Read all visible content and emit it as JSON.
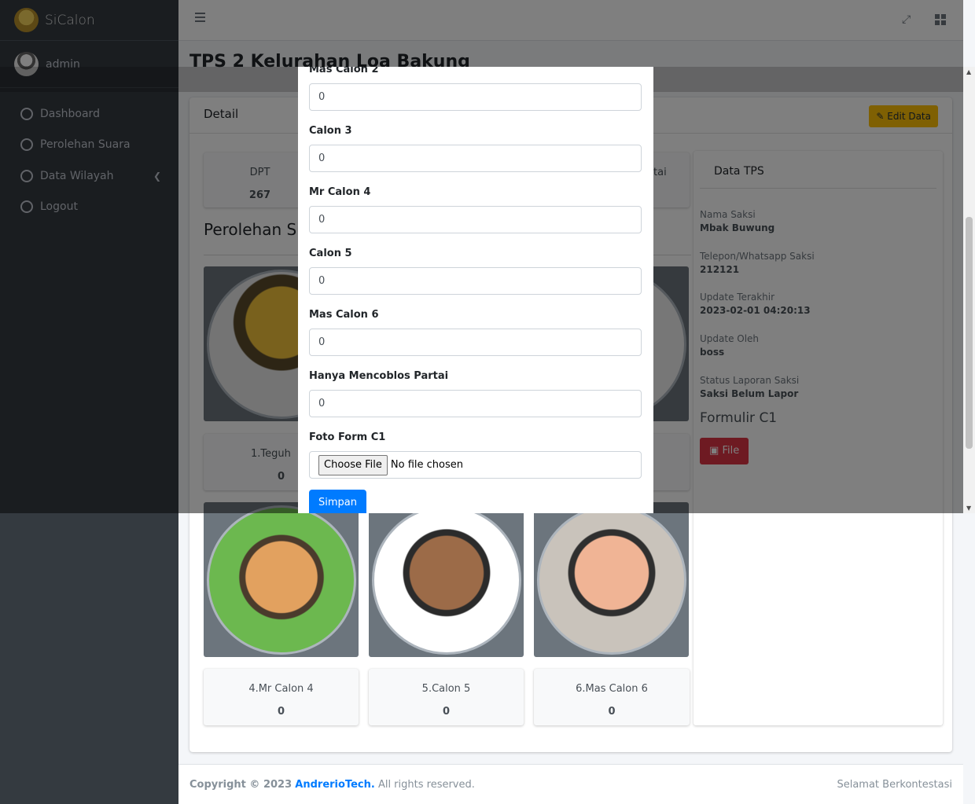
{
  "brand": {
    "name": "SiCalon"
  },
  "user": {
    "name": "admin"
  },
  "nav": {
    "items": [
      {
        "label": "Dashboard"
      },
      {
        "label": "Perolehan Suara"
      },
      {
        "label": "Data Wilayah"
      },
      {
        "label": "Logout"
      }
    ]
  },
  "page": {
    "title": "TPS 2 Kelurahan Loa Bakung"
  },
  "card": {
    "title": "Detail",
    "edit_label": "Edit Data"
  },
  "stats": [
    {
      "label": "DPT",
      "value": "267"
    }
  ],
  "stats_partial_label": "tai",
  "section": {
    "title": "Perolehan Suara",
    "partial": "Perolehan Su"
  },
  "candidates_top": [
    {
      "name_partial": "1.Teguh",
      "votes": "0"
    }
  ],
  "candidates_bottom": [
    {
      "name": "4.Mr Calon 4",
      "votes": "0"
    },
    {
      "name": "5.Calon 5",
      "votes": "0"
    },
    {
      "name": "6.Mas Calon 6",
      "votes": "0"
    }
  ],
  "tps": {
    "title": "Data TPS",
    "fields": [
      {
        "label": "Nama Saksi",
        "value": "Mbak Buwung"
      },
      {
        "label": "Telepon/Whatsapp Saksi",
        "value": "212121"
      },
      {
        "label": "Update Terakhir",
        "value": "2023-02-01 04:20:13"
      },
      {
        "label": "Update Oleh",
        "value": "boss"
      },
      {
        "label": "Status Laporan Saksi",
        "value": "Saksi Belum Lapor"
      }
    ],
    "form_title": "Formulir C1",
    "file_label": "File"
  },
  "modal": {
    "fields": [
      {
        "label": "Mas Calon 2",
        "value": "0"
      },
      {
        "label": "Calon 3",
        "value": "0"
      },
      {
        "label": "Mr Calon 4",
        "value": "0"
      },
      {
        "label": "Calon 5",
        "value": "0"
      },
      {
        "label": "Mas Calon 6",
        "value": "0"
      },
      {
        "label": "Hanya Mencoblos Partai",
        "value": "0"
      }
    ],
    "file_field_label": "Foto Form C1",
    "choose_file_label": "Choose File",
    "no_file_text": "No file chosen",
    "save_label": "Simpan"
  },
  "footer": {
    "copyright_prefix": "Copyright © 2023",
    "company": "AndrerioTech.",
    "rights": "All rights reserved.",
    "right_text": "Selamat Berkontestasi"
  },
  "colors": {
    "sidebar_bg": "#343a40",
    "primary": "#007bff",
    "warning": "#ffc107",
    "danger": "#dc3545"
  },
  "icons": [
    "menu-icon",
    "expand-icon",
    "grid-icon",
    "circle-icon",
    "chevron-left-icon",
    "edit-icon",
    "image-icon"
  ]
}
